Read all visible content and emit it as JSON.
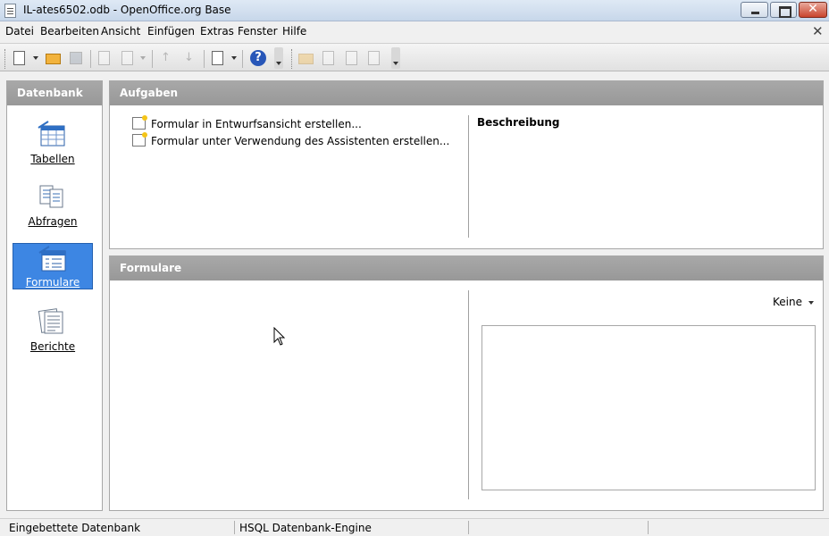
{
  "window": {
    "title": "IL-ates6502.odb - OpenOffice.org Base",
    "minimize_label": "",
    "close_symbol": "✕"
  },
  "menu": {
    "items": [
      "Datei",
      "Bearbeiten",
      "Ansicht",
      "Einfügen",
      "Extras",
      "Fenster",
      "Hilfe"
    ],
    "close_doc_symbol": "✕"
  },
  "toolbar": {
    "help_symbol": "?"
  },
  "sidebar": {
    "header": "Datenbank",
    "items": [
      {
        "label": "Tabellen",
        "selected": false
      },
      {
        "label": "Abfragen",
        "selected": false
      },
      {
        "label": "Formulare",
        "selected": true
      },
      {
        "label": "Berichte",
        "selected": false
      }
    ]
  },
  "tasks": {
    "header": "Aufgaben",
    "items": [
      "Formular in Entwurfsansicht erstellen...",
      "Formular unter Verwendung des Assistenten erstellen..."
    ],
    "description_title": "Beschreibung"
  },
  "forms": {
    "header": "Formulare",
    "preview_select": "Keine"
  },
  "status": {
    "left": "Eingebettete Datenbank",
    "engine": "HSQL Datenbank-Engine"
  },
  "colors": {
    "selected": "#3d86e3",
    "header_bg": "#a0a0a0"
  }
}
